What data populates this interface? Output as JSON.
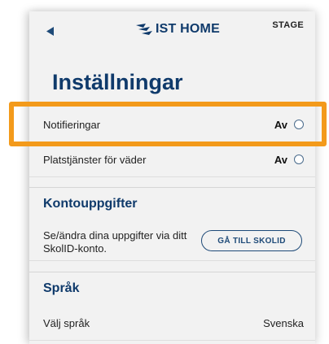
{
  "header": {
    "back_icon": "back-arrow-icon",
    "logo_icon": "ist-wings-icon",
    "logo_text": "IST HOME",
    "env_label": "STAGE"
  },
  "page": {
    "title": "Inställningar"
  },
  "settings": [
    {
      "label": "Notifieringar",
      "value": "Av",
      "selected": false
    },
    {
      "label": "Platstjänster för väder",
      "value": "Av",
      "selected": false
    }
  ],
  "account": {
    "section_title": "Kontouppgifter",
    "description": "Se/ändra dina uppgifter via ditt SkolID-konto.",
    "button_label": "GÅ TILL SKOLID"
  },
  "language": {
    "section_title": "Språk",
    "label": "Välj språk",
    "value": "Svenska"
  },
  "colors": {
    "brand": "#0f3a6b",
    "highlight": "#f39a1b",
    "background": "#f2f2f2"
  }
}
